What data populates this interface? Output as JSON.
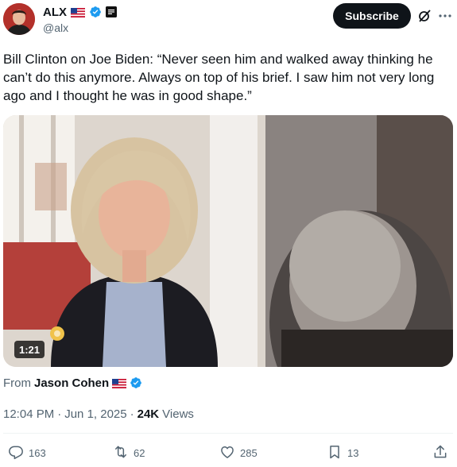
{
  "author": {
    "display_name": "ALX",
    "handle": "@alx"
  },
  "header": {
    "subscribe_label": "Subscribe"
  },
  "tweet": {
    "text": "Bill Clinton on Joe Biden: “Never seen him and walked away thinking he can’t do this anymore. Always on top of his brief. I saw him not very long ago and I thought he was in good shape.”"
  },
  "video": {
    "duration": "1:21"
  },
  "from": {
    "label": "From",
    "name": "Jason Cohen"
  },
  "meta": {
    "time": "12:04 PM",
    "separator": "·",
    "date": "Jun 1, 2025",
    "views_count": "24K",
    "views_label": "Views"
  },
  "actions": {
    "replies": "163",
    "reposts": "62",
    "likes": "285",
    "bookmarks": "13"
  },
  "icons": [
    "verified-icon",
    "us-flag-icon",
    "grok-icon",
    "more-icon",
    "reply-icon",
    "repost-icon",
    "like-icon",
    "bookmark-icon",
    "share-icon"
  ],
  "colors": {
    "verified": "#1d9bf0",
    "text_secondary": "#536471",
    "button_bg": "#0f1419"
  }
}
